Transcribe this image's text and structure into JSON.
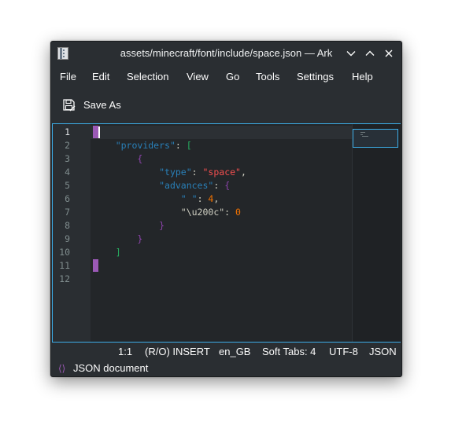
{
  "window": {
    "title": "assets/minecraft/font/include/space.json — Ark",
    "app_icon": "ark-archive-icon",
    "controls": [
      "minimize-chevron-down-icon",
      "maximize-chevron-up-icon",
      "close-icon"
    ]
  },
  "menu": {
    "items": [
      "File",
      "Edit",
      "Selection",
      "View",
      "Go",
      "Tools",
      "Settings",
      "Help"
    ]
  },
  "toolbar": {
    "save_as_label": "Save As",
    "save_as_icon": "document-save-as-icon"
  },
  "editor": {
    "line_numbers": [
      "1",
      "2",
      "3",
      "4",
      "5",
      "6",
      "7",
      "8",
      "9",
      "10",
      "11",
      "12"
    ],
    "lines": [
      [],
      [
        {
          "t": "    "
        },
        {
          "t": "\"providers\"",
          "c": "key"
        },
        {
          "t": ": "
        },
        {
          "t": "[",
          "c": "g"
        }
      ],
      [
        {
          "t": "        "
        },
        {
          "t": "{",
          "c": "p"
        }
      ],
      [
        {
          "t": "            "
        },
        {
          "t": "\"type\"",
          "c": "key"
        },
        {
          "t": ": "
        },
        {
          "t": "\"space\"",
          "c": "str"
        },
        {
          "t": ","
        }
      ],
      [
        {
          "t": "            "
        },
        {
          "t": "\"advances\"",
          "c": "key"
        },
        {
          "t": ": "
        },
        {
          "t": "{",
          "c": "p"
        }
      ],
      [
        {
          "t": "                "
        },
        {
          "t": "\" \"",
          "c": "key"
        },
        {
          "t": ": "
        },
        {
          "t": "4",
          "c": "num"
        },
        {
          "t": ","
        }
      ],
      [
        {
          "t": "                "
        },
        {
          "t": "\"\\u200c\"",
          "c": "c"
        },
        {
          "t": ": "
        },
        {
          "t": "0",
          "c": "num"
        }
      ],
      [
        {
          "t": "            "
        },
        {
          "t": "}",
          "c": "p"
        }
      ],
      [
        {
          "t": "        "
        },
        {
          "t": "}",
          "c": "p"
        }
      ],
      [
        {
          "t": "    "
        },
        {
          "t": "]",
          "c": "g"
        }
      ],
      [],
      []
    ],
    "current_line": 1,
    "modified_lines": [
      1,
      11
    ],
    "colors": {
      "key": "#2980b9",
      "string": "#f44f4f",
      "number": "#f67400",
      "brace": "#8e44ad",
      "bracket": "#27ae60",
      "marker": "#9b59b6",
      "focus": "#3daee9"
    }
  },
  "status": {
    "cursor_position": "1:1",
    "mode": "(R/O) INSERT",
    "language": "en_GB",
    "indentation": "Soft Tabs: 4",
    "encoding": "UTF-8",
    "syntax": "JSON"
  },
  "document": {
    "icon": "json-braces-icon",
    "icon_glyph": "⟨⟩",
    "type_label": "JSON document"
  }
}
